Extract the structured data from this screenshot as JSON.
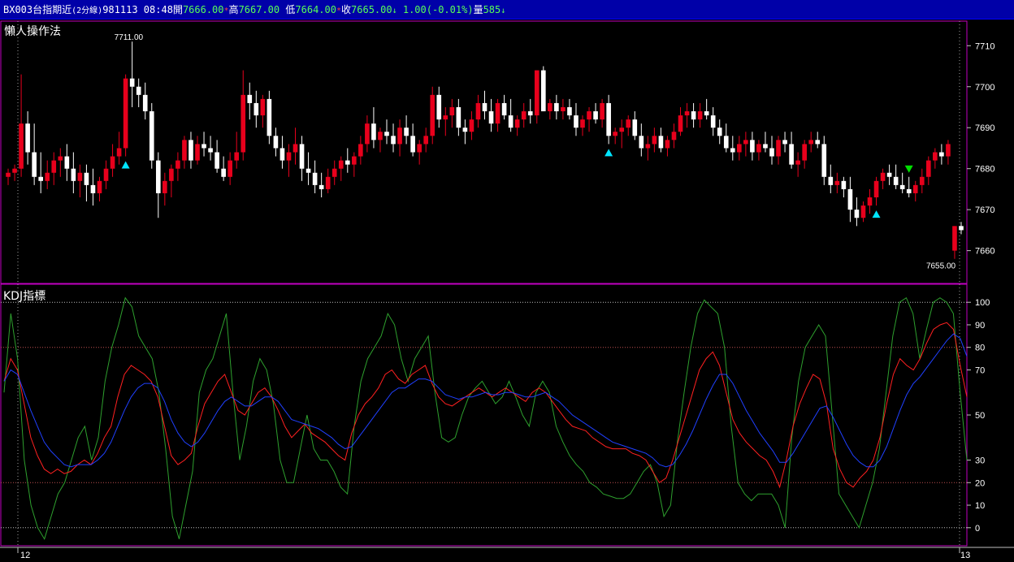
{
  "header": {
    "symbol": "BX003",
    "name": "台指期近",
    "interval": "(2分線)",
    "date": "981113",
    "time": "08:48",
    "open_label": "開",
    "open_value": "7666.00",
    "high_label": "高",
    "high_value": "7667.00",
    "low_label": "低",
    "low_value": "7664.00",
    "close_label": "收",
    "close_value": "7665.00",
    "change": "1.00(-0.01%)",
    "volume_label": "量",
    "volume_value": "585"
  },
  "colors": {
    "header_bg": "#0000a8",
    "bull": "#e8001c",
    "bear": "#ffffff",
    "k_line": "#ff2020",
    "d_line": "#2040ff",
    "j_line": "#2ea02e",
    "panel_border": "#c000c0",
    "signal_buy": "#00e5ff",
    "signal_sell": "#00e000"
  },
  "price_panel": {
    "title": "懶人操作法",
    "high_marker": "7711.00",
    "low_marker": "7655.00",
    "y_ticks": [
      "7710",
      "7700",
      "7690",
      "7680",
      "7670",
      "7660"
    ]
  },
  "kdj_panel": {
    "title": "KDJ指標",
    "y_ticks": [
      "100",
      "90",
      "80",
      "70",
      "50",
      "30",
      "20",
      "10",
      "0"
    ]
  },
  "x_axis": {
    "labels": [
      "12",
      "13"
    ]
  },
  "chart_data": {
    "type": "candlestick",
    "price_range": [
      7652,
      7716
    ],
    "kdj_range": [
      -8,
      108
    ],
    "signals": [
      {
        "type": "buy",
        "index": 18
      },
      {
        "type": "buy",
        "index": 92
      },
      {
        "type": "buy",
        "index": 133
      },
      {
        "type": "sell",
        "index": 138
      }
    ],
    "candles": [
      [
        7678,
        7680,
        7676,
        7679
      ],
      [
        7679,
        7681,
        7677,
        7680
      ],
      [
        7680,
        7703,
        7678,
        7691
      ],
      [
        7691,
        7694,
        7681,
        7684
      ],
      [
        7684,
        7691,
        7676,
        7678
      ],
      [
        7678,
        7684,
        7674,
        7677
      ],
      [
        7677,
        7682,
        7675,
        7679
      ],
      [
        7679,
        7684,
        7676,
        7682
      ],
      [
        7682,
        7685,
        7678,
        7683
      ],
      [
        7683,
        7686,
        7677,
        7680
      ],
      [
        7680,
        7684,
        7674,
        7677
      ],
      [
        7677,
        7681,
        7673,
        7679
      ],
      [
        7679,
        7681,
        7672,
        7676
      ],
      [
        7676,
        7680,
        7671,
        7674
      ],
      [
        7674,
        7678,
        7672,
        7677
      ],
      [
        7677,
        7682,
        7675,
        7680
      ],
      [
        7680,
        7686,
        7678,
        7683
      ],
      [
        7683,
        7689,
        7681,
        7685
      ],
      [
        7685,
        7703,
        7683,
        7702
      ],
      [
        7702,
        7711,
        7695,
        7700
      ],
      [
        7700,
        7702,
        7695,
        7698
      ],
      [
        7698,
        7701,
        7692,
        7694
      ],
      [
        7694,
        7696,
        7680,
        7682
      ],
      [
        7682,
        7684,
        7668,
        7674
      ],
      [
        7674,
        7679,
        7671,
        7677
      ],
      [
        7677,
        7681,
        7673,
        7680
      ],
      [
        7680,
        7684,
        7677,
        7682
      ],
      [
        7682,
        7688,
        7680,
        7687
      ],
      [
        7687,
        7689,
        7680,
        7682
      ],
      [
        7682,
        7688,
        7681,
        7686
      ],
      [
        7686,
        7689,
        7683,
        7685
      ],
      [
        7685,
        7688,
        7682,
        7684
      ],
      [
        7684,
        7687,
        7679,
        7680
      ],
      [
        7680,
        7683,
        7677,
        7678
      ],
      [
        7678,
        7684,
        7676,
        7682
      ],
      [
        7682,
        7689,
        7680,
        7684
      ],
      [
        7684,
        7704,
        7682,
        7698
      ],
      [
        7698,
        7701,
        7692,
        7696
      ],
      [
        7696,
        7699,
        7690,
        7693
      ],
      [
        7693,
        7698,
        7690,
        7697
      ],
      [
        7697,
        7699,
        7686,
        7688
      ],
      [
        7688,
        7690,
        7683,
        7685
      ],
      [
        7685,
        7688,
        7680,
        7682
      ],
      [
        7682,
        7686,
        7678,
        7684
      ],
      [
        7684,
        7690,
        7681,
        7686
      ],
      [
        7686,
        7688,
        7677,
        7680
      ],
      [
        7680,
        7684,
        7676,
        7679
      ],
      [
        7679,
        7682,
        7674,
        7676
      ],
      [
        7676,
        7679,
        7673,
        7675
      ],
      [
        7675,
        7680,
        7674,
        7678
      ],
      [
        7678,
        7682,
        7676,
        7680
      ],
      [
        7680,
        7683,
        7677,
        7682
      ],
      [
        7682,
        7685,
        7679,
        7681
      ],
      [
        7681,
        7684,
        7678,
        7683
      ],
      [
        7683,
        7688,
        7681,
        7686
      ],
      [
        7686,
        7693,
        7684,
        7691
      ],
      [
        7691,
        7695,
        7685,
        7687
      ],
      [
        7687,
        7690,
        7684,
        7689
      ],
      [
        7689,
        7692,
        7686,
        7688
      ],
      [
        7688,
        7691,
        7684,
        7686
      ],
      [
        7686,
        7692,
        7683,
        7690
      ],
      [
        7690,
        7693,
        7686,
        7688
      ],
      [
        7688,
        7691,
        7683,
        7684
      ],
      [
        7684,
        7687,
        7681,
        7686
      ],
      [
        7686,
        7690,
        7684,
        7688
      ],
      [
        7688,
        7700,
        7686,
        7698
      ],
      [
        7698,
        7700,
        7690,
        7692
      ],
      [
        7692,
        7695,
        7688,
        7693
      ],
      [
        7693,
        7697,
        7690,
        7695
      ],
      [
        7695,
        7697,
        7688,
        7690
      ],
      [
        7690,
        7692,
        7686,
        7689
      ],
      [
        7689,
        7694,
        7687,
        7692
      ],
      [
        7692,
        7698,
        7690,
        7696
      ],
      [
        7696,
        7699,
        7692,
        7694
      ],
      [
        7694,
        7697,
        7689,
        7691
      ],
      [
        7691,
        7697,
        7689,
        7696
      ],
      [
        7696,
        7698,
        7692,
        7693
      ],
      [
        7693,
        7697,
        7689,
        7690
      ],
      [
        7690,
        7693,
        7688,
        7692
      ],
      [
        7692,
        7696,
        7690,
        7694
      ],
      [
        7694,
        7697,
        7691,
        7693
      ],
      [
        7693,
        7704,
        7691,
        7704
      ],
      [
        7704,
        7705,
        7694,
        7694
      ],
      [
        7694,
        7697,
        7692,
        7696
      ],
      [
        7696,
        7698,
        7692,
        7694
      ],
      [
        7694,
        7697,
        7692,
        7695
      ],
      [
        7695,
        7697,
        7692,
        7693
      ],
      [
        7693,
        7696,
        7688,
        7690
      ],
      [
        7690,
        7693,
        7688,
        7692
      ],
      [
        7692,
        7695,
        7689,
        7694
      ],
      [
        7694,
        7696,
        7691,
        7692
      ],
      [
        7692,
        7697,
        7690,
        7696
      ],
      [
        7696,
        7698,
        7686,
        7688
      ],
      [
        7688,
        7690,
        7686,
        7689
      ],
      [
        7689,
        7692,
        7685,
        7690
      ],
      [
        7690,
        7693,
        7688,
        7692
      ],
      [
        7692,
        7694,
        7687,
        7688
      ],
      [
        7688,
        7691,
        7683,
        7685
      ],
      [
        7685,
        7688,
        7682,
        7686
      ],
      [
        7686,
        7690,
        7684,
        7688
      ],
      [
        7688,
        7690,
        7684,
        7685
      ],
      [
        7685,
        7688,
        7683,
        7687
      ],
      [
        7687,
        7691,
        7685,
        7689
      ],
      [
        7689,
        7695,
        7688,
        7693
      ],
      [
        7693,
        7696,
        7690,
        7694
      ],
      [
        7694,
        7696,
        7690,
        7692
      ],
      [
        7692,
        7696,
        7690,
        7694
      ],
      [
        7694,
        7697,
        7692,
        7693
      ],
      [
        7693,
        7695,
        7688,
        7690
      ],
      [
        7690,
        7692,
        7686,
        7688
      ],
      [
        7688,
        7691,
        7684,
        7685
      ],
      [
        7685,
        7688,
        7682,
        7684
      ],
      [
        7684,
        7688,
        7682,
        7686
      ],
      [
        7686,
        7689,
        7683,
        7687
      ],
      [
        7687,
        7689,
        7682,
        7684
      ],
      [
        7684,
        7687,
        7682,
        7686
      ],
      [
        7686,
        7689,
        7684,
        7685
      ],
      [
        7685,
        7688,
        7681,
        7683
      ],
      [
        7683,
        7688,
        7681,
        7687
      ],
      [
        7687,
        7689,
        7684,
        7686
      ],
      [
        7686,
        7689,
        7680,
        7681
      ],
      [
        7681,
        7684,
        7678,
        7682
      ],
      [
        7682,
        7687,
        7680,
        7686
      ],
      [
        7686,
        7689,
        7684,
        7687
      ],
      [
        7687,
        7689,
        7685,
        7686
      ],
      [
        7686,
        7688,
        7676,
        7678
      ],
      [
        7678,
        7681,
        7674,
        7676
      ],
      [
        7676,
        7679,
        7674,
        7677
      ],
      [
        7677,
        7678,
        7673,
        7675
      ],
      [
        7675,
        7678,
        7667,
        7670
      ],
      [
        7670,
        7673,
        7666,
        7668
      ],
      [
        7668,
        7672,
        7667,
        7671
      ],
      [
        7671,
        7675,
        7669,
        7673
      ],
      [
        7673,
        7678,
        7671,
        7677
      ],
      [
        7677,
        7680,
        7675,
        7679
      ],
      [
        7679,
        7681,
        7676,
        7678
      ],
      [
        7678,
        7681,
        7675,
        7676
      ],
      [
        7676,
        7679,
        7674,
        7675
      ],
      [
        7675,
        7678,
        7673,
        7674
      ],
      [
        7674,
        7677,
        7672,
        7676
      ],
      [
        7676,
        7680,
        7674,
        7678
      ],
      [
        7678,
        7683,
        7676,
        7682
      ],
      [
        7682,
        7685,
        7680,
        7684
      ],
      [
        7684,
        7686,
        7681,
        7683
      ],
      [
        7683,
        7687,
        7681,
        7686
      ],
      [
        7660,
        7666,
        7658,
        7666
      ],
      [
        7666,
        7667,
        7664,
        7665
      ]
    ],
    "series": [
      {
        "name": "K",
        "values": [
          65,
          75,
          70,
          55,
          40,
          32,
          26,
          24,
          26,
          24,
          25,
          28,
          30,
          28,
          33,
          40,
          45,
          58,
          68,
          72,
          70,
          68,
          65,
          58,
          45,
          32,
          28,
          30,
          33,
          45,
          55,
          60,
          65,
          68,
          60,
          52,
          50,
          55,
          60,
          62,
          58,
          52,
          45,
          40,
          43,
          46,
          42,
          40,
          38,
          35,
          32,
          30,
          42,
          50,
          55,
          58,
          62,
          68,
          70,
          66,
          64,
          68,
          70,
          72,
          64,
          58,
          55,
          54,
          56,
          58,
          60,
          62,
          60,
          58,
          60,
          62,
          60,
          58,
          56,
          60,
          62,
          60,
          56,
          52,
          48,
          45,
          44,
          43,
          40,
          38,
          36,
          35,
          35,
          35,
          33,
          32,
          30,
          25,
          20,
          22,
          30,
          40,
          50,
          60,
          70,
          75,
          78,
          72,
          60,
          48,
          42,
          38,
          35,
          32,
          30,
          25,
          18,
          30,
          45,
          55,
          62,
          68,
          66,
          55,
          35,
          26,
          20,
          18,
          22,
          25,
          30,
          40,
          55,
          68,
          75,
          72,
          70,
          75,
          82,
          88,
          90,
          91,
          88,
          72,
          58
        ]
      },
      {
        "name": "D",
        "values": [
          65,
          70,
          68,
          60,
          52,
          45,
          38,
          34,
          31,
          28,
          27,
          28,
          28,
          28,
          30,
          33,
          38,
          45,
          52,
          58,
          62,
          64,
          64,
          62,
          56,
          48,
          42,
          38,
          36,
          38,
          42,
          47,
          52,
          56,
          58,
          56,
          54,
          54,
          56,
          58,
          58,
          56,
          52,
          48,
          47,
          46,
          45,
          44,
          42,
          40,
          37,
          35,
          36,
          40,
          44,
          48,
          52,
          56,
          60,
          62,
          62,
          64,
          66,
          66,
          65,
          62,
          59,
          58,
          57,
          58,
          58,
          59,
          60,
          59,
          59,
          60,
          60,
          59,
          58,
          58,
          59,
          60,
          58,
          56,
          53,
          50,
          48,
          46,
          44,
          42,
          40,
          38,
          37,
          36,
          35,
          34,
          33,
          31,
          28,
          27,
          28,
          32,
          37,
          43,
          50,
          57,
          63,
          68,
          68,
          64,
          58,
          52,
          47,
          42,
          38,
          34,
          29,
          29,
          33,
          38,
          43,
          48,
          53,
          54,
          49,
          43,
          37,
          32,
          29,
          27,
          27,
          30,
          36,
          44,
          52,
          59,
          64,
          67,
          71,
          75,
          79,
          83,
          86,
          84,
          76
        ]
      },
      {
        "name": "J",
        "values": [
          60,
          95,
          75,
          30,
          10,
          0,
          -5,
          5,
          15,
          20,
          30,
          40,
          45,
          30,
          40,
          65,
          80,
          90,
          102,
          98,
          85,
          80,
          75,
          60,
          35,
          5,
          -5,
          10,
          25,
          60,
          70,
          75,
          85,
          95,
          60,
          30,
          45,
          65,
          75,
          70,
          55,
          30,
          20,
          20,
          35,
          50,
          35,
          30,
          30,
          25,
          18,
          15,
          45,
          65,
          75,
          80,
          85,
          95,
          90,
          75,
          65,
          75,
          80,
          85,
          60,
          40,
          38,
          40,
          50,
          58,
          62,
          65,
          60,
          55,
          58,
          65,
          58,
          50,
          45,
          60,
          65,
          60,
          45,
          38,
          32,
          28,
          25,
          20,
          18,
          15,
          14,
          13,
          13,
          15,
          20,
          25,
          28,
          20,
          5,
          10,
          38,
          60,
          80,
          95,
          101,
          98,
          95,
          80,
          45,
          20,
          15,
          12,
          15,
          15,
          15,
          10,
          0,
          40,
          65,
          80,
          85,
          90,
          85,
          50,
          15,
          10,
          5,
          0,
          10,
          20,
          35,
          60,
          85,
          100,
          102,
          95,
          75,
          88,
          100,
          102,
          100,
          95,
          60,
          30
        ]
      }
    ]
  }
}
